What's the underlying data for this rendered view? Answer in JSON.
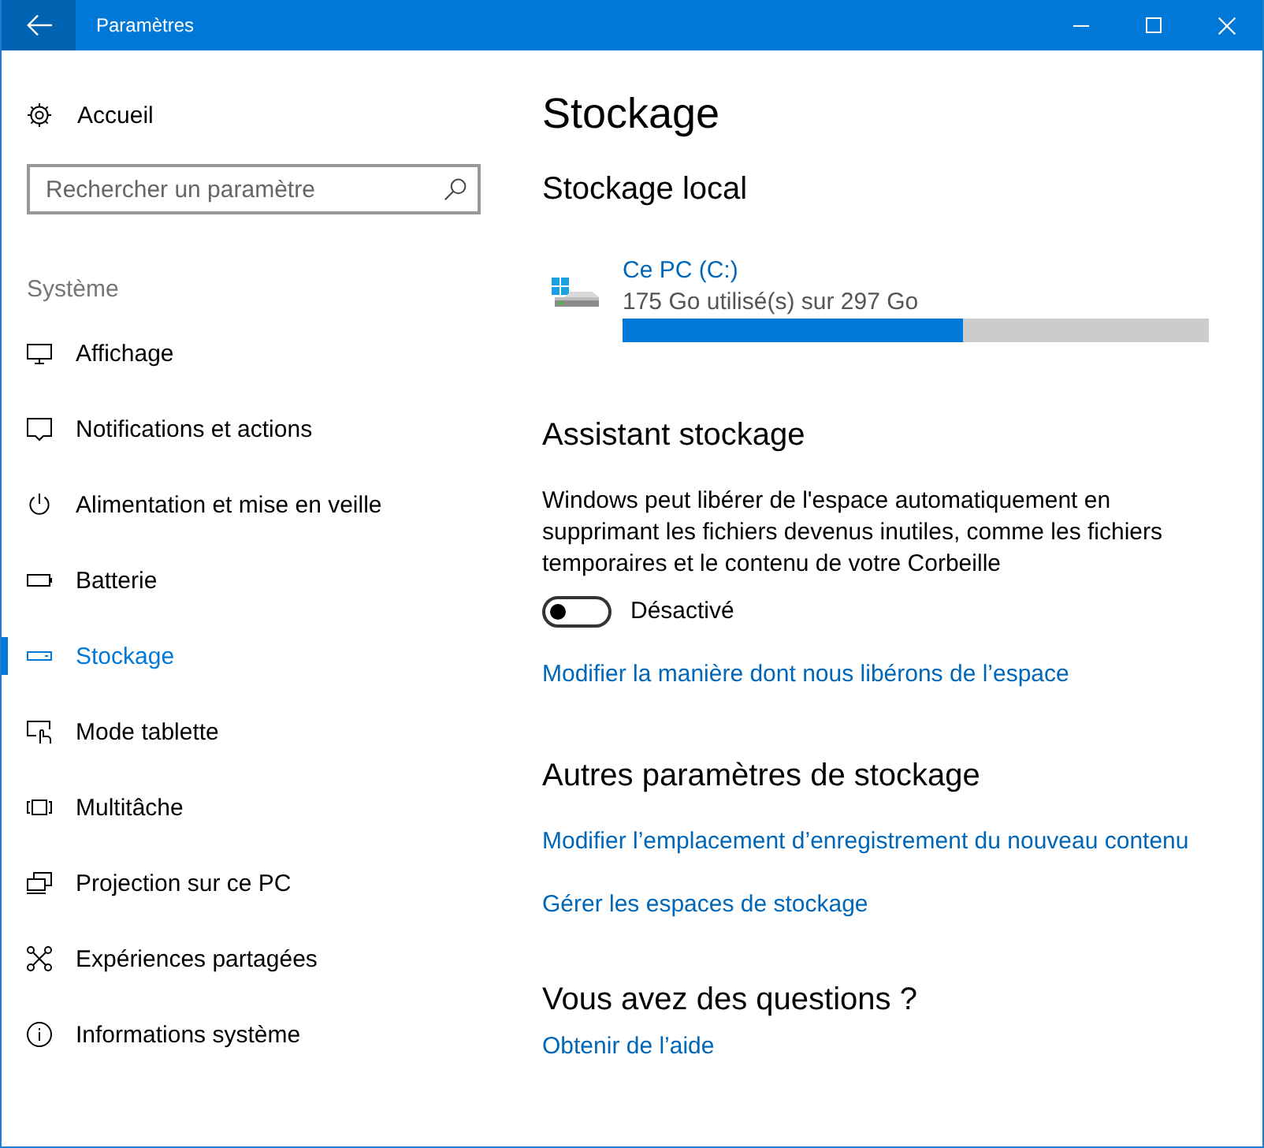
{
  "window": {
    "title": "Paramètres"
  },
  "sidebar": {
    "home": "Accueil",
    "search": {
      "placeholder": "Rechercher un paramètre"
    },
    "section": "Système",
    "items": [
      {
        "label": "Affichage",
        "selected": false
      },
      {
        "label": "Notifications et actions",
        "selected": false
      },
      {
        "label": "Alimentation et mise en veille",
        "selected": false
      },
      {
        "label": "Batterie",
        "selected": false
      },
      {
        "label": "Stockage",
        "selected": true
      },
      {
        "label": "Mode tablette",
        "selected": false
      },
      {
        "label": "Multitâche",
        "selected": false
      },
      {
        "label": "Projection sur ce PC",
        "selected": false
      },
      {
        "label": "Expériences partagées",
        "selected": false
      },
      {
        "label": "Informations système",
        "selected": false
      }
    ]
  },
  "main": {
    "title": "Stockage",
    "local": {
      "heading": "Stockage local",
      "drives": [
        {
          "name": "Ce PC (C:)",
          "usage": "175 Go utilisé(s) sur 297 Go",
          "level": 0.58
        }
      ]
    },
    "storage_sense": {
      "heading": "Assistant stockage",
      "description": "Windows peut libérer de l'espace automatiquement en supprimant les fichiers devenus inutiles, comme les fichiers temporaires et le contenu de votre Corbeille",
      "toggle": {
        "on": false,
        "label": "Désactivé"
      },
      "links": [
        "Modifier la manière dont nous libérons de l’espace"
      ]
    },
    "other": {
      "heading": "Autres paramètres de stockage",
      "links": [
        "Modifier l’emplacement d’enregistrement du nouveau contenu",
        "Gérer les espaces de stockage"
      ]
    },
    "help": {
      "heading": "Vous avez des questions ?",
      "links": [
        "Obtenir de l’aide"
      ]
    }
  }
}
